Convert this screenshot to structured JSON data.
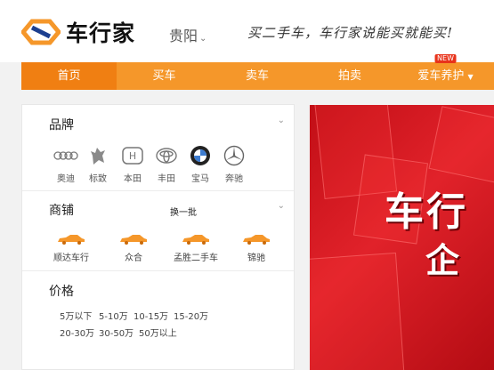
{
  "header": {
    "logo_text": "车行家",
    "city": "贵阳",
    "slogan": "买二手车，车行家说能买就能买!"
  },
  "nav": {
    "items": [
      {
        "label": "首页"
      },
      {
        "label": "买车"
      },
      {
        "label": "卖车"
      },
      {
        "label": "拍卖"
      },
      {
        "label": "爱车养护",
        "badge": "NEW"
      }
    ]
  },
  "brand_section": {
    "title": "品牌",
    "brands": [
      {
        "label": "奥迪",
        "icon": "audi-logo-icon"
      },
      {
        "label": "标致",
        "icon": "peugeot-logo-icon"
      },
      {
        "label": "本田",
        "icon": "honda-logo-icon"
      },
      {
        "label": "丰田",
        "icon": "toyota-logo-icon"
      },
      {
        "label": "宝马",
        "icon": "bmw-logo-icon"
      },
      {
        "label": "奔驰",
        "icon": "mercedes-logo-icon"
      }
    ]
  },
  "shop_section": {
    "title": "商铺",
    "swap_label": "换一批",
    "shops": [
      {
        "label": "顺达车行"
      },
      {
        "label": "众合"
      },
      {
        "label": "孟胜二手车"
      },
      {
        "label": "锦驰"
      }
    ]
  },
  "price_section": {
    "title": "价格",
    "ranges": [
      "5万以下",
      "5-10万",
      "10-15万",
      "15-20万",
      "20-30万",
      "30-50万",
      "50万以上"
    ]
  },
  "banner": {
    "text_line1": "车行",
    "text_line2": "企"
  },
  "colors": {
    "nav_bg": "#f5972a",
    "nav_active": "#f07f12",
    "banner_red": "#d7131c",
    "badge_red": "#e8331b"
  }
}
